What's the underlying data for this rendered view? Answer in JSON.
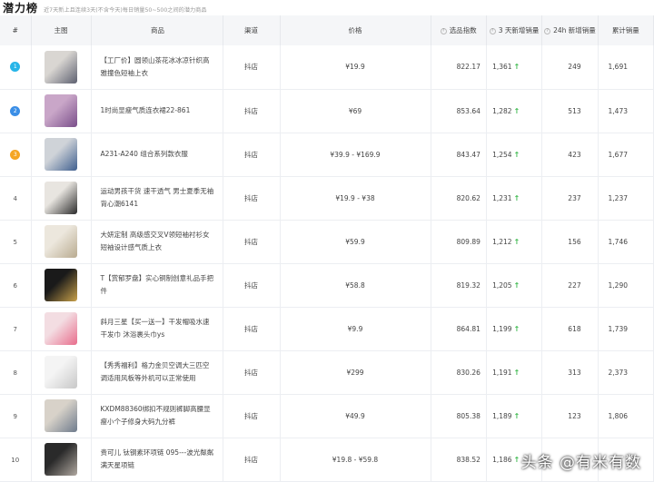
{
  "page": {
    "title": "潜力榜",
    "subtitle": "近7天新上且连续3天(不含今天)每日销量50~500之间的潜力商品"
  },
  "columns": {
    "rank": "#",
    "image": "主图",
    "name": "商品",
    "channel": "渠道",
    "price": "价格",
    "score": "选品指数",
    "sales3d": "3 天新增销量",
    "sales24h": "24h 新增销量",
    "total": "累计销量"
  },
  "colors": {
    "rank1": "#27b5e8",
    "rank2": "#3a8ee6",
    "rank3": "#f5a623",
    "up_arrow": "#3fb950"
  },
  "rows": [
    {
      "rank": "1",
      "name": "【工厂价】圆领山茶花冰冰凉针织高雅撞色短袖上衣",
      "channel": "抖店",
      "price": "¥19.9",
      "score": "822.17",
      "sales3d": "1,361",
      "sales24h": "249",
      "total": "1,691",
      "thumb_colors": [
        "#d9d6d2",
        "#5d6070"
      ]
    },
    {
      "rank": "2",
      "name": "1时尚显瘦气质连衣裙22-861",
      "channel": "抖店",
      "price": "¥69",
      "score": "853.64",
      "sales3d": "1,282",
      "sales24h": "513",
      "total": "1,473",
      "thumb_colors": [
        "#c9a6c8",
        "#7a4f8a"
      ]
    },
    {
      "rank": "3",
      "name": "A231-A240 组合系列款衣服",
      "channel": "抖店",
      "price": "¥39.9 - ¥169.9",
      "score": "843.47",
      "sales3d": "1,254",
      "sales24h": "423",
      "total": "1,677",
      "thumb_colors": [
        "#cfd3d8",
        "#3f5f8f"
      ]
    },
    {
      "rank": "4",
      "name": "运动男孩干货 速干透气 男士夏季无袖背心潮6141",
      "channel": "抖店",
      "price": "¥19.9 - ¥38",
      "score": "820.62",
      "sales3d": "1,231",
      "sales24h": "237",
      "total": "1,237",
      "thumb_colors": [
        "#e8e5e0",
        "#2b2b2b"
      ]
    },
    {
      "rank": "5",
      "name": "大妍定制 高级感交叉V领短袖衬衫女短袖设计感气质上衣",
      "channel": "抖店",
      "price": "¥59.9",
      "score": "809.89",
      "sales3d": "1,212",
      "sales24h": "156",
      "total": "1,746",
      "thumb_colors": [
        "#ece7dd",
        "#b9ab90"
      ]
    },
    {
      "rank": "6",
      "name": "T【赏郁罗盘】实心铜制创意礼品手把件",
      "channel": "抖店",
      "price": "¥58.8",
      "score": "819.32",
      "sales3d": "1,205",
      "sales24h": "227",
      "total": "1,290",
      "thumb_colors": [
        "#1a1a1a",
        "#c9a14a"
      ]
    },
    {
      "rank": "7",
      "name": "斜月三星【买一送一】干发帽吸水速干发巾 沐浴裹头巾ys",
      "channel": "抖店",
      "price": "¥9.9",
      "score": "864.81",
      "sales3d": "1,199",
      "sales24h": "618",
      "total": "1,739",
      "thumb_colors": [
        "#f3dde2",
        "#e86d8c"
      ]
    },
    {
      "rank": "8",
      "name": "【秀秀福利】格力金贝空调大三匹空调适用风板等外机可以正常使用",
      "channel": "抖店",
      "price": "¥299",
      "score": "830.26",
      "sales3d": "1,191",
      "sales24h": "313",
      "total": "2,373",
      "thumb_colors": [
        "#f4f4f4",
        "#c8c8c8"
      ]
    },
    {
      "rank": "9",
      "name": "KXDM88360绑扣不规则裤脚高腰显瘦小个子修身大码九分裤",
      "channel": "抖店",
      "price": "¥49.9",
      "score": "805.38",
      "sales3d": "1,189",
      "sales24h": "123",
      "total": "1,806",
      "thumb_colors": [
        "#d8d2c9",
        "#6e7b8c"
      ]
    },
    {
      "rank": "10",
      "name": "贵可儿 钛钢素环项链 095---波光粼粼满天星项链",
      "channel": "抖店",
      "price": "¥19.8 - ¥59.8",
      "score": "838.52",
      "sales3d": "1,186",
      "sales24h": "",
      "total": "",
      "thumb_colors": [
        "#2a2a2a",
        "#b0a8a0"
      ]
    }
  ],
  "watermark": {
    "text": "头条 @有米有数",
    "logo": "toutiao-logo-icon"
  }
}
